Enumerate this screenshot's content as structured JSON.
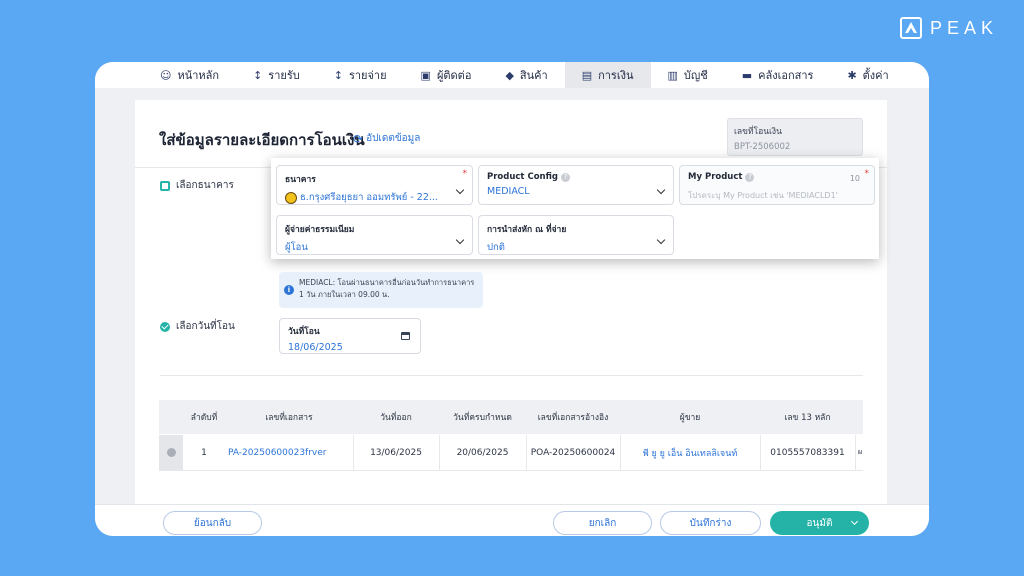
{
  "brand": {
    "name": "PEAK"
  },
  "nav": {
    "items": [
      {
        "label": "หน้าหลัก",
        "icon": "☺"
      },
      {
        "label": "รายรับ",
        "icon": "↕"
      },
      {
        "label": "รายจ่าย",
        "icon": "↕"
      },
      {
        "label": "ผู้ติดต่อ",
        "icon": "▣"
      },
      {
        "label": "สินค้า",
        "icon": "◆"
      },
      {
        "label": "การเงิน",
        "icon": "▤"
      },
      {
        "label": "บัญชี",
        "icon": "▥"
      },
      {
        "label": "คลังเอกสาร",
        "icon": "▬"
      },
      {
        "label": "ตั้งค่า",
        "icon": "✱"
      }
    ],
    "active_index": 5
  },
  "page": {
    "title": "ใส่ข้อมูลรายละเอียดการโอนเงิน",
    "update_link": "อัปเดตข้อมูล",
    "doc_no_label": "เลขที่โอนเงิน",
    "doc_no_value": "BPT-2506002"
  },
  "sections": {
    "bank_label": "เลือกธนาคาร",
    "date_label": "เลือกวันที่โอน"
  },
  "form": {
    "bank": {
      "label": "ธนาคาร",
      "value": "ธ.กรุงศรีอยุธยา ออมทรัพย์ - 22..."
    },
    "product_config": {
      "label": "Product Config",
      "value": "MEDIACL"
    },
    "my_product": {
      "label": "My Product",
      "placeholder": "โปรดระบุ My Product เช่น 'MEDIACLD1'",
      "counter": "10"
    },
    "fee_payer": {
      "label": "ผู้จ่ายค่าธรรมเนียม",
      "value": "ผู้โอน"
    },
    "delivery": {
      "label": "การนำส่งหัก ณ ที่จ่าย",
      "value": "ปกติ"
    }
  },
  "info": {
    "line1": "MEDIACL: โอนผ่านธนาคารอื่นก่อนวันทำการธนาคาร",
    "line2": "1 วัน ภายในเวลา 09.00 น."
  },
  "transfer_date": {
    "label": "วันที่โอน",
    "value": "18/06/2025"
  },
  "table": {
    "headers": [
      "ลำดับที่",
      "เลขที่เอกสาร",
      "วันที่ออก",
      "วันที่ครบกำหนด",
      "เลขที่เอกสารอ้างอิง",
      "ผู้ขาย",
      "เลข 13 หลัก"
    ],
    "rows": [
      {
        "no": "1",
        "doc_no": "PA-20250600023frver",
        "issue_date": "13/06/2025",
        "due_date": "20/06/2025",
        "ref_no": "POA-20250600024",
        "vendor": "พี ยู ยู เอ็น อินเทลลิเจนท์",
        "tax_id": "0105557083391",
        "extra": "ผ ถ"
      }
    ]
  },
  "footer": {
    "back": "ย้อนกลับ",
    "cancel": "ยกเลิก",
    "draft": "บันทึกร่าง",
    "approve": "อนุมัติ"
  }
}
